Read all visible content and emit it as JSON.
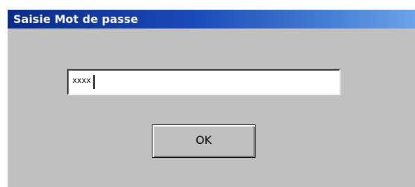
{
  "window": {
    "title": "Saisie Mot de passe"
  },
  "password_field": {
    "value": "xxxx"
  },
  "ok_button": {
    "label": "OK"
  },
  "colors": {
    "dialog_background": "#c0c0c0",
    "titlebar_start": "#0a2a8a",
    "titlebar_end": "#6aa4e8",
    "title_text": "#ffffff"
  }
}
